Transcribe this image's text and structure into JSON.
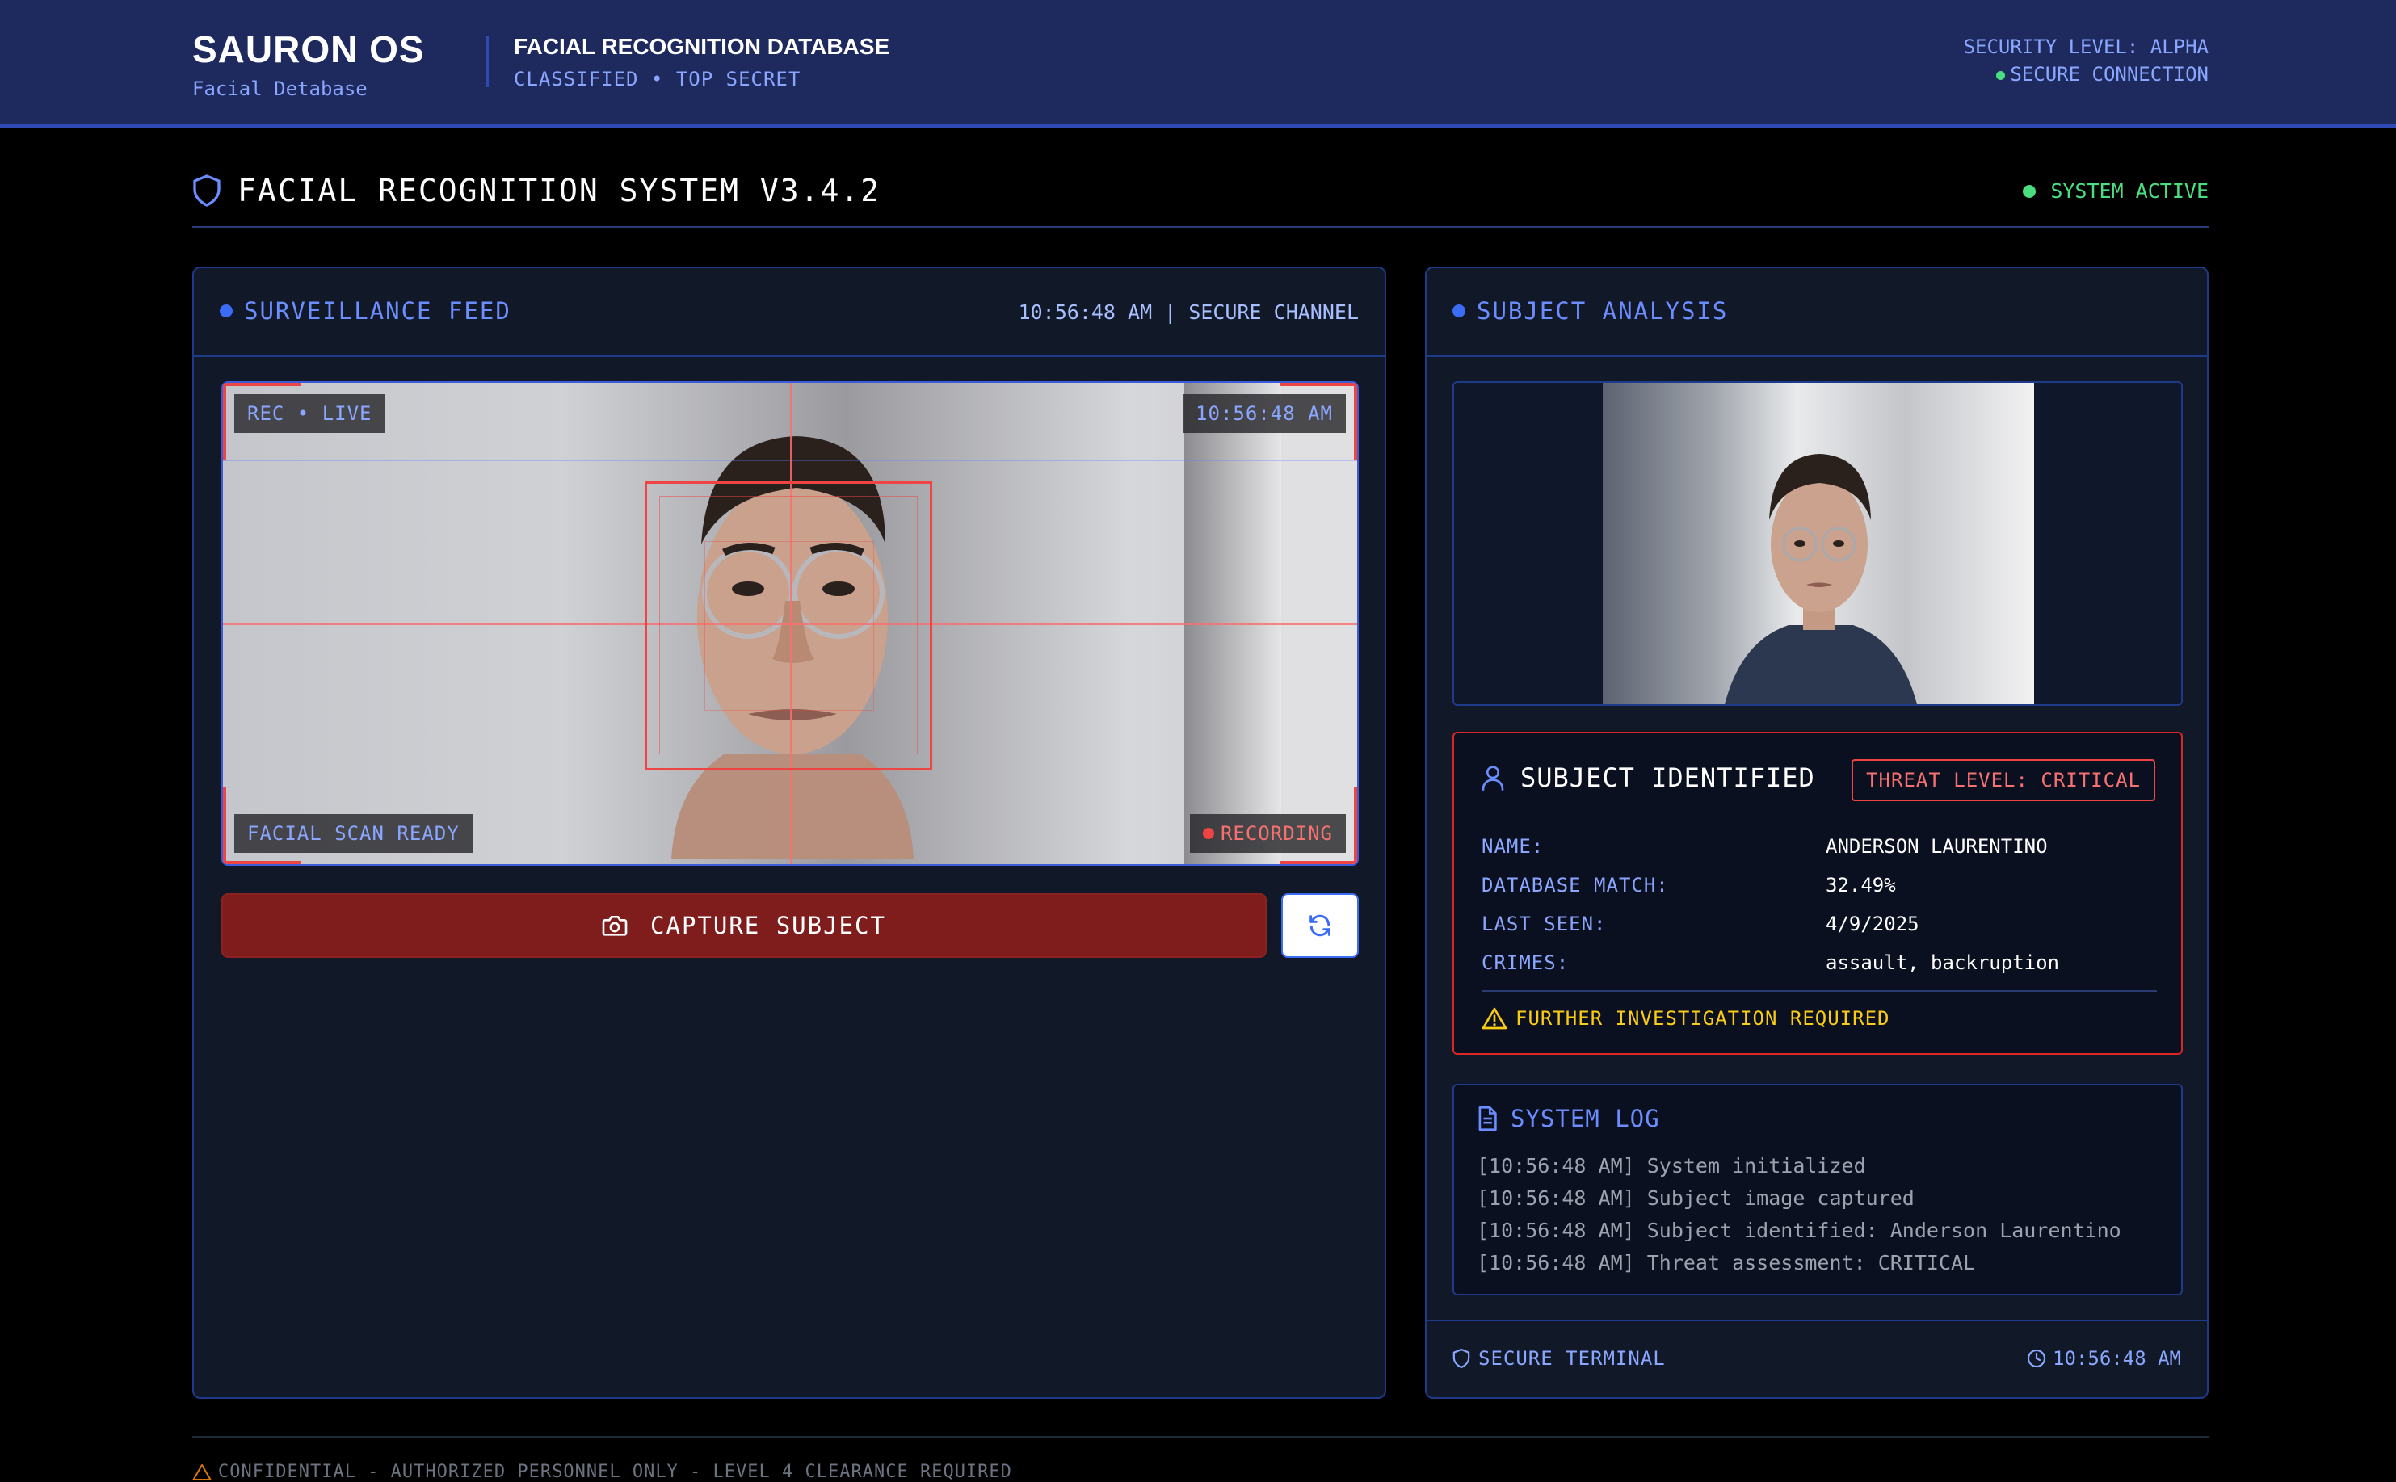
{
  "header": {
    "brand_title": "SAURON OS",
    "brand_subtitle": "Facial Detabase",
    "database_title": "FACIAL RECOGNITION DATABASE",
    "classification": "CLASSIFIED • TOP SECRET",
    "security_level": "SECURITY LEVEL: ALPHA",
    "connection_status": "SECURE CONNECTION"
  },
  "page": {
    "title": "FACIAL RECOGNITION SYSTEM V3.4.2",
    "status": "SYSTEM ACTIVE"
  },
  "feed_panel": {
    "title": "SURVEILLANCE FEED",
    "channel_info": "10:56:48 AM | SECURE CHANNEL",
    "tag_rec": "REC • LIVE",
    "tag_time": "10:56:48 AM",
    "tag_scan": "FACIAL SCAN READY",
    "tag_recording": "RECORDING",
    "capture_label": "CAPTURE SUBJECT"
  },
  "analysis_panel": {
    "title": "SUBJECT ANALYSIS",
    "identified_title": "SUBJECT IDENTIFIED",
    "threat_label": "THREAT LEVEL: CRITICAL",
    "fields": [
      {
        "key": "NAME:",
        "value": "ANDERSON LAURENTINO"
      },
      {
        "key": "DATABASE MATCH:",
        "value": "32.49%"
      },
      {
        "key": "LAST SEEN:",
        "value": "4/9/2025"
      },
      {
        "key": "CRIMES:",
        "value": "assault, backruption"
      }
    ],
    "warning": "FURTHER INVESTIGATION REQUIRED",
    "log_title": "SYSTEM LOG",
    "log": [
      "[10:56:48 AM] System initialized",
      "[10:56:48 AM] Subject image captured",
      "[10:56:48 AM] Subject identified: Anderson Laurentino",
      "[10:56:48 AM] Threat assessment: CRITICAL"
    ],
    "footer_left": "SECURE TERMINAL",
    "footer_time": "10:56:48 AM"
  },
  "footer": {
    "notice": "CONFIDENTIAL - AUTHORIZED PERSONNEL ONLY - LEVEL 4 CLEARANCE REQUIRED"
  },
  "icons": {
    "page_title": "shield-icon",
    "capture": "camera-icon",
    "refresh": "refresh-icon",
    "subject": "user-icon",
    "warning": "warning-triangle-icon",
    "log": "document-icon",
    "terminal": "shield-icon",
    "clock": "clock-icon"
  },
  "colors": {
    "header_bg": "#1e2a5e",
    "accent_blue": "#6b8dff",
    "alert_red": "#ef4444",
    "capture_button": "#7f1d1d",
    "active_green": "#4ade80",
    "warning_yellow": "#facc15"
  }
}
